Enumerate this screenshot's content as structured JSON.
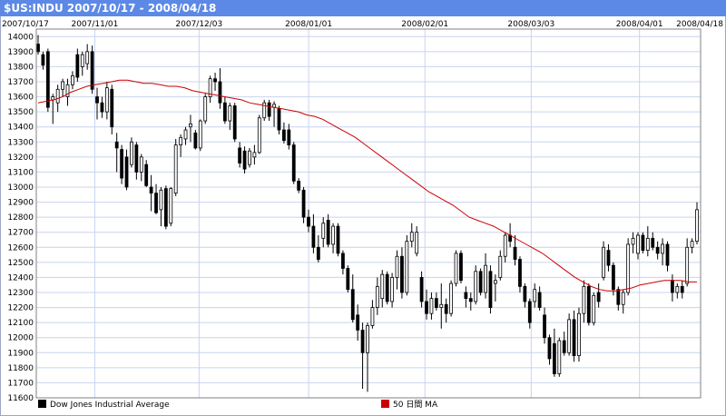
{
  "title": "$US:INDU 2007/10/17 - 2008/04/18",
  "colors": {
    "title_bar": "#5c89e6",
    "grid": "#c8d4ee",
    "candle": "#000000",
    "ma_line": "#cc0000"
  },
  "chart_data": {
    "type": "candlestick",
    "title": "$US:INDU 2007/10/17 - 2008/04/18",
    "x_tick_labels": [
      "2007/10/17",
      "2007/11/01",
      "2007/12/03",
      "2008/01/01",
      "2008/02/01",
      "2008/03/03",
      "2008/04/01",
      "2008/04/18"
    ],
    "y_tick_labels": [
      "11600",
      "11700",
      "11800",
      "11900",
      "12000",
      "12100",
      "12200",
      "12300",
      "12400",
      "12500",
      "12600",
      "12700",
      "12800",
      "12900",
      "13000",
      "13100",
      "13200",
      "13300",
      "13400",
      "13500",
      "13600",
      "13700",
      "13800",
      "13900",
      "14000"
    ],
    "ylim": [
      11600,
      14050
    ],
    "grid": true,
    "legend_position": "bottom",
    "series": [
      {
        "name": "Dow Jones Industrial Average",
        "color": "#000000",
        "ohlc": [
          {
            "o": 13950,
            "h": 14010,
            "l": 13880,
            "c": 13900
          },
          {
            "o": 13880,
            "h": 13900,
            "l": 13780,
            "c": 13810
          },
          {
            "o": 13900,
            "h": 13920,
            "l": 13500,
            "c": 13530
          },
          {
            "o": 13580,
            "h": 13620,
            "l": 13420,
            "c": 13600
          },
          {
            "o": 13560,
            "h": 13680,
            "l": 13500,
            "c": 13650
          },
          {
            "o": 13650,
            "h": 13720,
            "l": 13600,
            "c": 13700
          },
          {
            "o": 13600,
            "h": 13720,
            "l": 13540,
            "c": 13680
          },
          {
            "o": 13680,
            "h": 13770,
            "l": 13650,
            "c": 13740
          },
          {
            "o": 13880,
            "h": 13920,
            "l": 13700,
            "c": 13730
          },
          {
            "o": 13800,
            "h": 13900,
            "l": 13740,
            "c": 13880
          },
          {
            "o": 13820,
            "h": 13950,
            "l": 13780,
            "c": 13900
          },
          {
            "o": 13900,
            "h": 13940,
            "l": 13620,
            "c": 13650
          },
          {
            "o": 13600,
            "h": 13660,
            "l": 13450,
            "c": 13560
          },
          {
            "o": 13560,
            "h": 13600,
            "l": 13460,
            "c": 13500
          },
          {
            "o": 13500,
            "h": 13700,
            "l": 13450,
            "c": 13660
          },
          {
            "o": 13650,
            "h": 13680,
            "l": 13350,
            "c": 13400
          },
          {
            "o": 13300,
            "h": 13360,
            "l": 13100,
            "c": 13260
          },
          {
            "o": 13250,
            "h": 13280,
            "l": 13020,
            "c": 13060
          },
          {
            "o": 13200,
            "h": 13250,
            "l": 12980,
            "c": 13000
          },
          {
            "o": 13150,
            "h": 13330,
            "l": 13130,
            "c": 13300
          },
          {
            "o": 13280,
            "h": 13300,
            "l": 13050,
            "c": 13100
          },
          {
            "o": 13100,
            "h": 13220,
            "l": 13040,
            "c": 13200
          },
          {
            "o": 13150,
            "h": 13180,
            "l": 13000,
            "c": 13010
          },
          {
            "o": 13000,
            "h": 13080,
            "l": 12840,
            "c": 12960
          },
          {
            "o": 12960,
            "h": 13020,
            "l": 12820,
            "c": 12830
          },
          {
            "o": 12850,
            "h": 13000,
            "l": 12740,
            "c": 12980
          },
          {
            "o": 12990,
            "h": 13010,
            "l": 12720,
            "c": 12740
          },
          {
            "o": 12760,
            "h": 13000,
            "l": 12740,
            "c": 12990
          },
          {
            "o": 12960,
            "h": 13320,
            "l": 12940,
            "c": 13280
          },
          {
            "o": 13280,
            "h": 13350,
            "l": 13200,
            "c": 13330
          },
          {
            "o": 13320,
            "h": 13400,
            "l": 13280,
            "c": 13380
          },
          {
            "o": 13400,
            "h": 13480,
            "l": 13300,
            "c": 13420
          },
          {
            "o": 13360,
            "h": 13380,
            "l": 13250,
            "c": 13260
          },
          {
            "o": 13260,
            "h": 13450,
            "l": 13240,
            "c": 13440
          },
          {
            "o": 13440,
            "h": 13620,
            "l": 13420,
            "c": 13600
          },
          {
            "o": 13600,
            "h": 13740,
            "l": 13560,
            "c": 13720
          },
          {
            "o": 13720,
            "h": 13760,
            "l": 13640,
            "c": 13700
          },
          {
            "o": 13700,
            "h": 13790,
            "l": 13520,
            "c": 13560
          },
          {
            "o": 13560,
            "h": 13600,
            "l": 13420,
            "c": 13440
          },
          {
            "o": 13440,
            "h": 13560,
            "l": 13380,
            "c": 13540
          },
          {
            "o": 13540,
            "h": 13560,
            "l": 13300,
            "c": 13320
          },
          {
            "o": 13260,
            "h": 13300,
            "l": 13130,
            "c": 13160
          },
          {
            "o": 13240,
            "h": 13270,
            "l": 13090,
            "c": 13120
          },
          {
            "o": 13150,
            "h": 13260,
            "l": 13130,
            "c": 13240
          },
          {
            "o": 13200,
            "h": 13280,
            "l": 13150,
            "c": 13230
          },
          {
            "o": 13230,
            "h": 13480,
            "l": 13220,
            "c": 13460
          },
          {
            "o": 13460,
            "h": 13580,
            "l": 13440,
            "c": 13560
          },
          {
            "o": 13560,
            "h": 13580,
            "l": 13440,
            "c": 13470
          },
          {
            "o": 13530,
            "h": 13570,
            "l": 13400,
            "c": 13550
          },
          {
            "o": 13520,
            "h": 13540,
            "l": 13350,
            "c": 13380
          },
          {
            "o": 13380,
            "h": 13430,
            "l": 13290,
            "c": 13310
          },
          {
            "o": 13380,
            "h": 13420,
            "l": 13250,
            "c": 13280
          },
          {
            "o": 13280,
            "h": 13300,
            "l": 13020,
            "c": 13040
          },
          {
            "o": 13040,
            "h": 13060,
            "l": 12960,
            "c": 12980
          },
          {
            "o": 12980,
            "h": 13000,
            "l": 12760,
            "c": 12800
          },
          {
            "o": 12800,
            "h": 12850,
            "l": 12700,
            "c": 12740
          },
          {
            "o": 12740,
            "h": 12820,
            "l": 12560,
            "c": 12600
          },
          {
            "o": 12600,
            "h": 12680,
            "l": 12500,
            "c": 12520
          },
          {
            "o": 12660,
            "h": 12800,
            "l": 12600,
            "c": 12760
          },
          {
            "o": 12780,
            "h": 12820,
            "l": 12600,
            "c": 12620
          },
          {
            "o": 12620,
            "h": 12760,
            "l": 12560,
            "c": 12740
          },
          {
            "o": 12740,
            "h": 12760,
            "l": 12540,
            "c": 12560
          },
          {
            "o": 12560,
            "h": 12580,
            "l": 12420,
            "c": 12460
          },
          {
            "o": 12460,
            "h": 12480,
            "l": 12300,
            "c": 12320
          },
          {
            "o": 12320,
            "h": 12420,
            "l": 12100,
            "c": 12120
          },
          {
            "o": 12150,
            "h": 12220,
            "l": 11980,
            "c": 12050
          },
          {
            "o": 12050,
            "h": 12100,
            "l": 11660,
            "c": 11900
          },
          {
            "o": 11900,
            "h": 12100,
            "l": 11640,
            "c": 12080
          },
          {
            "o": 12080,
            "h": 12250,
            "l": 12060,
            "c": 12200
          },
          {
            "o": 12200,
            "h": 12400,
            "l": 12150,
            "c": 12340
          },
          {
            "o": 12260,
            "h": 12450,
            "l": 12200,
            "c": 12420
          },
          {
            "o": 12420,
            "h": 12440,
            "l": 12220,
            "c": 12240
          },
          {
            "o": 12240,
            "h": 12430,
            "l": 12200,
            "c": 12400
          },
          {
            "o": 12400,
            "h": 12580,
            "l": 12320,
            "c": 12540
          },
          {
            "o": 12540,
            "h": 12600,
            "l": 12260,
            "c": 12300
          },
          {
            "o": 12300,
            "h": 12680,
            "l": 12280,
            "c": 12640
          },
          {
            "o": 12640,
            "h": 12760,
            "l": 12600,
            "c": 12700
          },
          {
            "o": 12560,
            "h": 12740,
            "l": 12540,
            "c": 12700
          },
          {
            "o": 12400,
            "h": 12440,
            "l": 12200,
            "c": 12240
          },
          {
            "o": 12240,
            "h": 12320,
            "l": 12120,
            "c": 12160
          },
          {
            "o": 12160,
            "h": 12300,
            "l": 12120,
            "c": 12260
          },
          {
            "o": 12260,
            "h": 12300,
            "l": 12180,
            "c": 12200
          },
          {
            "o": 12200,
            "h": 12360,
            "l": 12060,
            "c": 12220
          },
          {
            "o": 12220,
            "h": 12260,
            "l": 12100,
            "c": 12160
          },
          {
            "o": 12160,
            "h": 12380,
            "l": 12140,
            "c": 12360
          },
          {
            "o": 12360,
            "h": 12580,
            "l": 12340,
            "c": 12560
          },
          {
            "o": 12560,
            "h": 12580,
            "l": 12360,
            "c": 12380
          },
          {
            "o": 12300,
            "h": 12340,
            "l": 12200,
            "c": 12260
          },
          {
            "o": 12260,
            "h": 12300,
            "l": 12180,
            "c": 12240
          },
          {
            "o": 12240,
            "h": 12480,
            "l": 12220,
            "c": 12440
          },
          {
            "o": 12440,
            "h": 12460,
            "l": 12280,
            "c": 12300
          },
          {
            "o": 12300,
            "h": 12560,
            "l": 12260,
            "c": 12480
          },
          {
            "o": 12440,
            "h": 12480,
            "l": 12160,
            "c": 12200
          },
          {
            "o": 12360,
            "h": 12420,
            "l": 12240,
            "c": 12380
          },
          {
            "o": 12400,
            "h": 12580,
            "l": 12380,
            "c": 12540
          },
          {
            "o": 12540,
            "h": 12700,
            "l": 12500,
            "c": 12680
          },
          {
            "o": 12680,
            "h": 12760,
            "l": 12600,
            "c": 12640
          },
          {
            "o": 12600,
            "h": 12680,
            "l": 12480,
            "c": 12520
          },
          {
            "o": 12520,
            "h": 12540,
            "l": 12300,
            "c": 12340
          },
          {
            "o": 12340,
            "h": 12360,
            "l": 12200,
            "c": 12240
          },
          {
            "o": 12240,
            "h": 12260,
            "l": 12060,
            "c": 12100
          },
          {
            "o": 12240,
            "h": 12360,
            "l": 12200,
            "c": 12320
          },
          {
            "o": 12300,
            "h": 12340,
            "l": 12180,
            "c": 12200
          },
          {
            "o": 12150,
            "h": 12200,
            "l": 11960,
            "c": 12000
          },
          {
            "o": 12000,
            "h": 12020,
            "l": 11820,
            "c": 11860
          },
          {
            "o": 11960,
            "h": 12060,
            "l": 11740,
            "c": 11760
          },
          {
            "o": 11760,
            "h": 12000,
            "l": 11740,
            "c": 11980
          },
          {
            "o": 11980,
            "h": 12040,
            "l": 11880,
            "c": 11900
          },
          {
            "o": 11900,
            "h": 12160,
            "l": 11880,
            "c": 12120
          },
          {
            "o": 12120,
            "h": 12180,
            "l": 11840,
            "c": 11880
          },
          {
            "o": 11880,
            "h": 12200,
            "l": 11840,
            "c": 12160
          },
          {
            "o": 12160,
            "h": 12380,
            "l": 12100,
            "c": 12340
          },
          {
            "o": 12340,
            "h": 12360,
            "l": 12080,
            "c": 12100
          },
          {
            "o": 12100,
            "h": 12300,
            "l": 12080,
            "c": 12280
          },
          {
            "o": 12300,
            "h": 12360,
            "l": 12200,
            "c": 12240
          },
          {
            "o": 12400,
            "h": 12640,
            "l": 12380,
            "c": 12600
          },
          {
            "o": 12580,
            "h": 12620,
            "l": 12440,
            "c": 12480
          },
          {
            "o": 12480,
            "h": 12500,
            "l": 12280,
            "c": 12320
          },
          {
            "o": 12320,
            "h": 12340,
            "l": 12180,
            "c": 12220
          },
          {
            "o": 12220,
            "h": 12320,
            "l": 12160,
            "c": 12300
          },
          {
            "o": 12300,
            "h": 12660,
            "l": 12280,
            "c": 12620
          },
          {
            "o": 12620,
            "h": 12700,
            "l": 12560,
            "c": 12660
          },
          {
            "o": 12560,
            "h": 12700,
            "l": 12520,
            "c": 12680
          },
          {
            "o": 12680,
            "h": 12700,
            "l": 12560,
            "c": 12580
          },
          {
            "o": 12580,
            "h": 12740,
            "l": 12540,
            "c": 12660
          },
          {
            "o": 12660,
            "h": 12700,
            "l": 12580,
            "c": 12600
          },
          {
            "o": 12600,
            "h": 12640,
            "l": 12520,
            "c": 12560
          },
          {
            "o": 12560,
            "h": 12660,
            "l": 12480,
            "c": 12620
          },
          {
            "o": 12620,
            "h": 12640,
            "l": 12440,
            "c": 12480
          },
          {
            "o": 12380,
            "h": 12420,
            "l": 12240,
            "c": 12300
          },
          {
            "o": 12300,
            "h": 12360,
            "l": 12260,
            "c": 12340
          },
          {
            "o": 12340,
            "h": 12380,
            "l": 12260,
            "c": 12300
          },
          {
            "o": 12360,
            "h": 12660,
            "l": 12340,
            "c": 12600
          },
          {
            "o": 12600,
            "h": 12660,
            "l": 12560,
            "c": 12640
          },
          {
            "o": 12640,
            "h": 12900,
            "l": 12620,
            "c": 12850
          }
        ]
      },
      {
        "name": "50 日間 MA",
        "color": "#cc0000",
        "values": [
          13560,
          13570,
          13580,
          13600,
          13630,
          13650,
          13670,
          13680,
          13690,
          13700,
          13710,
          13710,
          13700,
          13690,
          13690,
          13680,
          13670,
          13670,
          13660,
          13640,
          13630,
          13620,
          13610,
          13600,
          13590,
          13580,
          13560,
          13550,
          13540,
          13530,
          13520,
          13510,
          13500,
          13480,
          13470,
          13450,
          13420,
          13390,
          13360,
          13330,
          13290,
          13250,
          13210,
          13170,
          13130,
          13090,
          13050,
          13010,
          12970,
          12940,
          12910,
          12880,
          12840,
          12800,
          12780,
          12760,
          12740,
          12710,
          12680,
          12650,
          12620,
          12590,
          12560,
          12520,
          12480,
          12440,
          12400,
          12370,
          12340,
          12320,
          12310,
          12310,
          12320,
          12330,
          12350,
          12360,
          12370,
          12380,
          12380,
          12380,
          12370,
          12370
        ]
      }
    ]
  },
  "legend": {
    "items": [
      {
        "label": "Dow Jones Industrial Average",
        "color": "#000000"
      },
      {
        "label": "50 日間 MA",
        "color": "#cc0000"
      }
    ]
  }
}
